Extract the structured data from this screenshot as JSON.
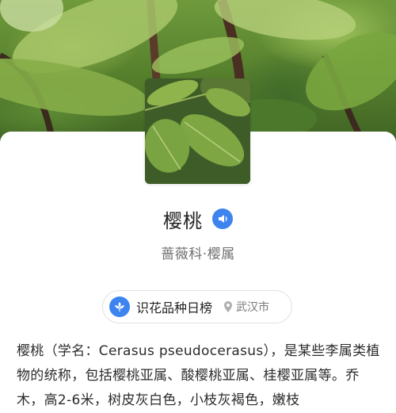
{
  "header": {
    "background_image": "blurred-leaves-photo",
    "thumbnail_image": "cherry-leaves-photo"
  },
  "plant": {
    "name": "樱桃",
    "family": "蔷薇科·樱属",
    "speaker_icon": "speaker-icon"
  },
  "ranking": {
    "label": "识花品种日榜",
    "city": "武汉市",
    "icon": "flower-badge-icon",
    "location_icon": "location-pin-icon"
  },
  "description": {
    "text": "樱桃（学名：Cerasus pseudocerasus），是某些李属类植物的统称，包括樱桃亚属、酸樱桃亚属、桂樱亚属等。乔木，高2-6米，树皮灰白色，小枝灰褐色，嫩枝"
  },
  "colors": {
    "accent": "#3d84f0",
    "title": "#222222",
    "subtitle": "#6f6f6f"
  }
}
